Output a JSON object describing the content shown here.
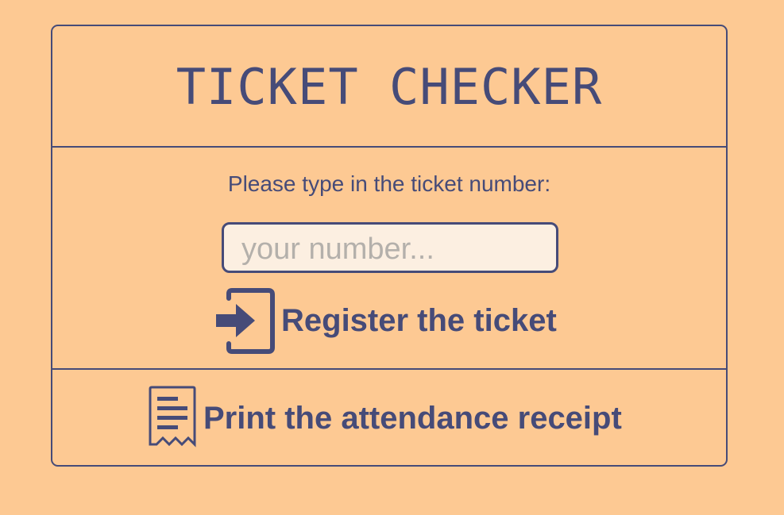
{
  "app": {
    "title": "TICKET CHECKER"
  },
  "form": {
    "prompt": "Please type in the ticket number:",
    "input_placeholder": "your number...",
    "input_value": ""
  },
  "actions": {
    "register_label": "Register the ticket",
    "register_icon": "sign-in-icon",
    "print_label": "Print the attendance receipt",
    "print_icon": "receipt-icon"
  },
  "colors": {
    "background": "#fdc993",
    "accent": "#464b78",
    "input_background": "#fcefe1",
    "placeholder": "#b4b0ab"
  }
}
